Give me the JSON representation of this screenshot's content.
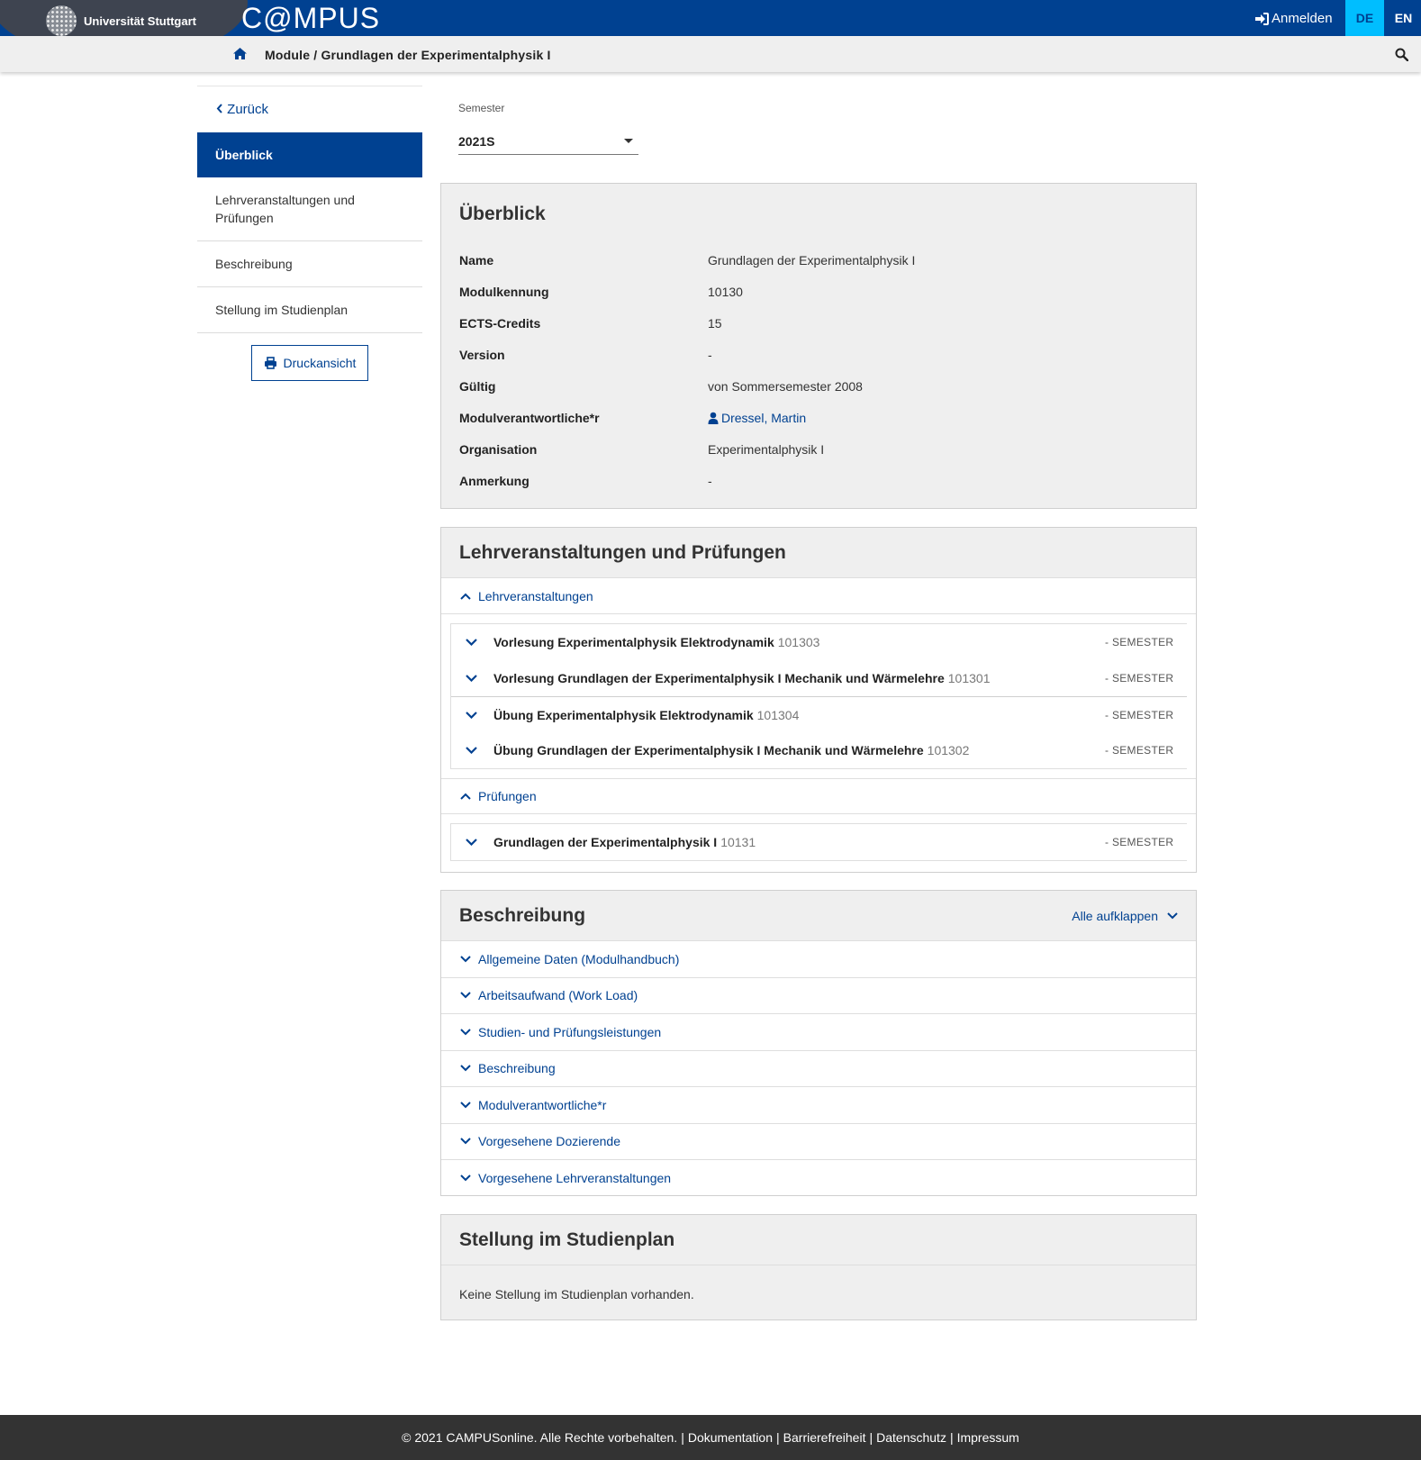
{
  "header": {
    "university": "Universität Stuttgart",
    "app_name": "C@MPUS",
    "login_label": "Anmelden",
    "lang_de": "DE",
    "lang_en": "EN",
    "accent_color": "#004191",
    "lang_active_color": "#00beff"
  },
  "breadcrumb": {
    "text": "Module / Grundlagen der Experimentalphysik I"
  },
  "sidebar": {
    "back_label": "Zurück",
    "items": [
      {
        "label": "Überblick",
        "active": true
      },
      {
        "label": "Lehrveranstaltungen und Prüfungen"
      },
      {
        "label": "Beschreibung"
      },
      {
        "label": "Stellung im Studienplan"
      }
    ],
    "print_label": "Druckansicht"
  },
  "semester": {
    "label": "Semester",
    "value": "2021S"
  },
  "overview": {
    "title": "Überblick",
    "rows": [
      {
        "key": "Name",
        "value": "Grundlagen der Experimentalphysik I"
      },
      {
        "key": "Modulkennung",
        "value": "10130"
      },
      {
        "key": "ECTS-Credits",
        "value": "15"
      },
      {
        "key": "Version",
        "value": "-"
      },
      {
        "key": "Gültig",
        "value": "von Sommersemester 2008"
      },
      {
        "key": "Modulverantwortliche*r",
        "value": "Dressel, Martin"
      },
      {
        "key": "Organisation",
        "value": "Experimentalphysik I"
      },
      {
        "key": "Anmerkung",
        "value": "-"
      }
    ]
  },
  "courses": {
    "title": "Lehrveranstaltungen und Prüfungen",
    "lv_label": "Lehrveranstaltungen",
    "pruef_label": "Prüfungen",
    "semester_tag": "SEMESTER",
    "dash": "-",
    "lv_items": [
      {
        "title": "Vorlesung Experimentalphysik Elektrodynamik",
        "number": "101303"
      },
      {
        "title": "Vorlesung Grundlagen der Experimentalphysik I Mechanik und Wärmelehre",
        "number": "101301"
      },
      {
        "title": "Übung Experimentalphysik Elektrodynamik",
        "number": "101304"
      },
      {
        "title": "Übung Grundlagen der Experimentalphysik I Mechanik und Wärmelehre",
        "number": "101302"
      }
    ],
    "pruef_items": [
      {
        "title": "Grundlagen der Experimentalphysik I",
        "number": "10131"
      }
    ]
  },
  "description": {
    "title": "Beschreibung",
    "expand_all": "Alle aufklappen",
    "items": [
      "Allgemeine Daten (Modulhandbuch)",
      "Arbeitsaufwand (Work Load)",
      "Studien- und Prüfungsleistungen",
      "Beschreibung",
      "Modulverantwortliche*r",
      "Vorgesehene Dozierende",
      "Vorgesehene Lehrveranstaltungen"
    ]
  },
  "studyplan": {
    "title": "Stellung im Studienplan",
    "text": "Keine Stellung im Studienplan vorhanden."
  },
  "footer": {
    "copyright": "© 2021 CAMPUSonline. Alle Rechte vorbehalten.",
    "sep": "|",
    "links": [
      "Dokumentation",
      "Barrierefreiheit",
      "Datenschutz",
      "Impressum"
    ]
  }
}
